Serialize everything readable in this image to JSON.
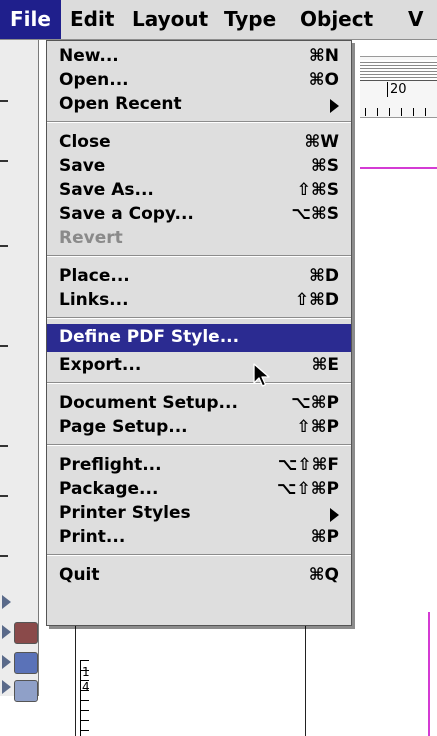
{
  "menubar": {
    "items": [
      {
        "label": "File"
      },
      {
        "label": "Edit"
      },
      {
        "label": "Layout"
      },
      {
        "label": "Type"
      },
      {
        "label": "Object"
      },
      {
        "label": "V"
      }
    ]
  },
  "document": {
    "ruler_label": "20",
    "vertical_ruler_labels": [
      "1",
      "4"
    ],
    "guide_color": "#d43bd4"
  },
  "file_menu": {
    "highlight_color": "#2b2b91",
    "items": [
      {
        "label": "New...",
        "shortcut": "⌘N"
      },
      {
        "label": "Open...",
        "shortcut": "⌘O"
      },
      {
        "label": "Open Recent",
        "shortcut": "",
        "submenu": true
      },
      {
        "label": "Close",
        "shortcut": "⌘W"
      },
      {
        "label": "Save",
        "shortcut": "⌘S"
      },
      {
        "label": "Save As...",
        "shortcut": "⇧⌘S"
      },
      {
        "label": "Save a Copy...",
        "shortcut": "⌥⌘S"
      },
      {
        "label": "Revert",
        "shortcut": "",
        "disabled": true
      },
      {
        "label": "Place...",
        "shortcut": "⌘D"
      },
      {
        "label": "Links...",
        "shortcut": "⇧⌘D"
      },
      {
        "label": "Define PDF Style...",
        "shortcut": "",
        "highlighted": true
      },
      {
        "label": "Export...",
        "shortcut": "⌘E"
      },
      {
        "label": "Document Setup...",
        "shortcut": "⌥⌘P"
      },
      {
        "label": "Page Setup...",
        "shortcut": "⇧⌘P"
      },
      {
        "label": "Preflight...",
        "shortcut": "⌥⇧⌘F"
      },
      {
        "label": "Package...",
        "shortcut": "⌥⇧⌘P"
      },
      {
        "label": "Printer Styles",
        "shortcut": "",
        "submenu": true
      },
      {
        "label": "Print...",
        "shortcut": "⌘P"
      },
      {
        "label": "Quit",
        "shortcut": "⌘Q"
      }
    ]
  }
}
